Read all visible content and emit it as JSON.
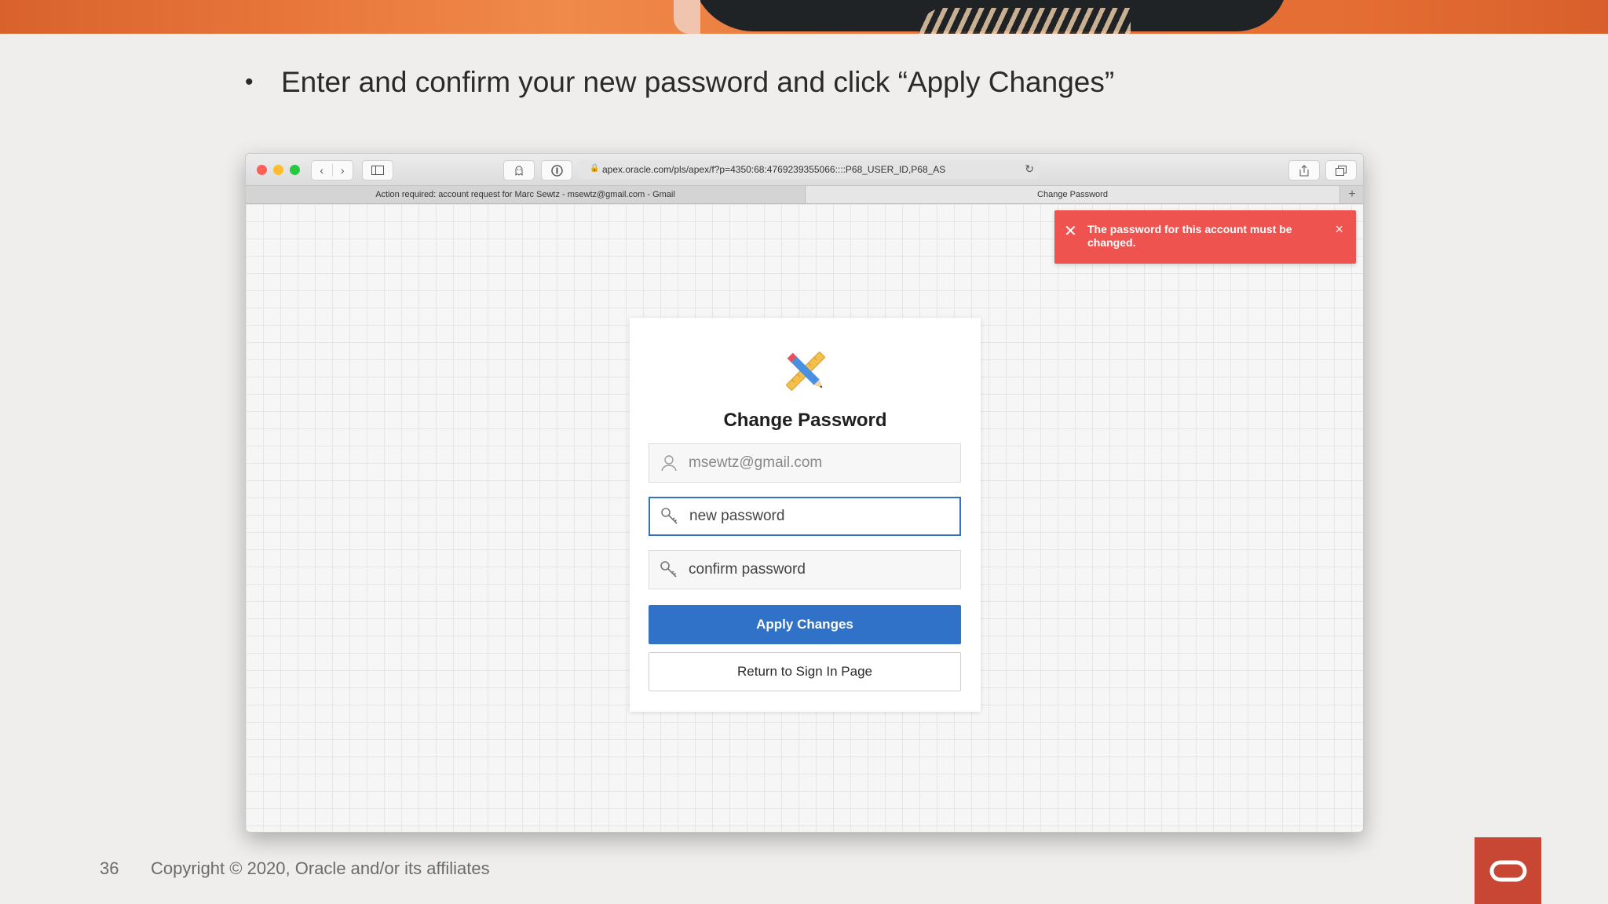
{
  "slide": {
    "bullet_text": "Enter and confirm your new password and click “Apply Changes”",
    "page_number": "36",
    "copyright": "Copyright © 2020, Oracle and/or its affiliates"
  },
  "browser": {
    "url": "apex.oracle.com/pls/apex/f?p=4350:68:4769239355066::::P68_USER_ID,P68_AS",
    "tabs": [
      {
        "label": "Action required: account request for Marc Sewtz - msewtz@gmail.com - Gmail",
        "active": false
      },
      {
        "label": "Change Password",
        "active": true
      }
    ]
  },
  "alert": {
    "message": "The password for this account must be changed."
  },
  "form": {
    "title": "Change Password",
    "username_value": "msewtz@gmail.com",
    "new_password_placeholder": "new password",
    "confirm_password_placeholder": "confirm password",
    "apply_label": "Apply Changes",
    "return_label": "Return to Sign In Page"
  },
  "colors": {
    "primary": "#2f72c8",
    "alert": "#ef5350",
    "oracle_red": "#c74634"
  }
}
